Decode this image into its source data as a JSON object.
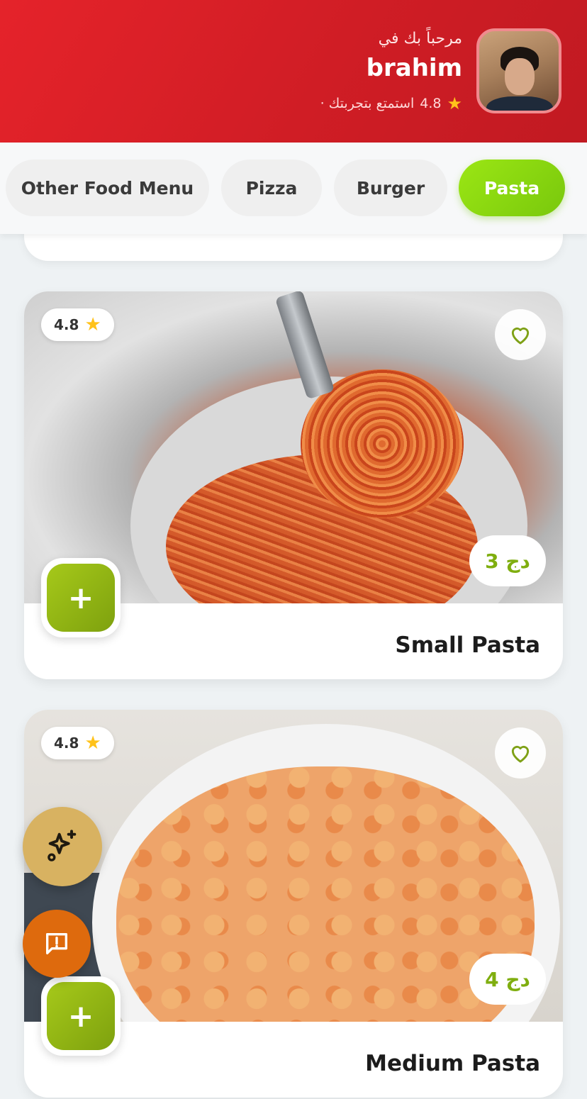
{
  "header": {
    "greeting": "مرحباً بك في",
    "username": "brahim",
    "rating": "4.8",
    "rating_text": "· استمتع بتجربتك",
    "avatar_icon": "user-photo"
  },
  "categories": [
    {
      "label": "Other Food Menu",
      "active": false
    },
    {
      "label": "Pizza",
      "active": false
    },
    {
      "label": "Burger",
      "active": false
    },
    {
      "label": "Pasta",
      "active": true
    }
  ],
  "products": [
    {
      "name": "Small Pasta",
      "price": "3 دج",
      "rating": "4.8"
    },
    {
      "name": "Medium Pasta",
      "price": "4 دج",
      "rating": "4.8"
    }
  ],
  "actions": {
    "add_symbol": "+",
    "ai_icon": "sparkles-icon",
    "feedback_icon": "message-alert-icon",
    "favorite_icon": "heart-icon"
  },
  "colors": {
    "header_red": "#d01d25",
    "active_green": "#8ad611",
    "price_green": "#7fae0f",
    "star_yellow": "#ffc21a",
    "ai_gold": "#d8b261",
    "feedback_orange": "#de6a0d"
  }
}
